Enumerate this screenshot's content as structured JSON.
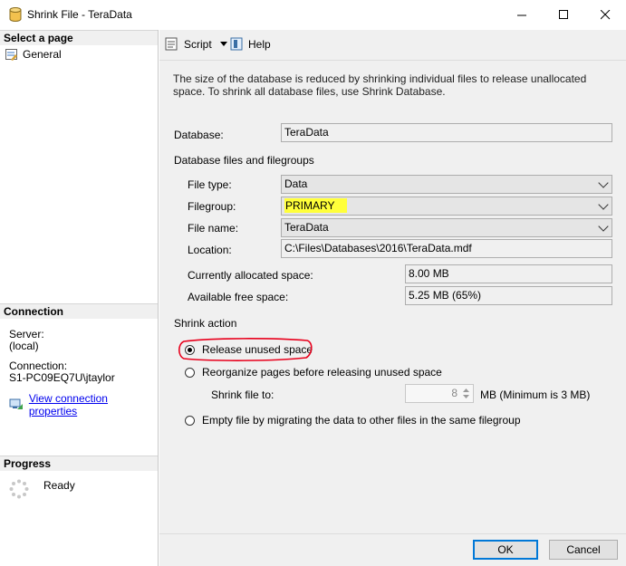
{
  "window": {
    "title": "Shrink File - TeraData"
  },
  "left": {
    "select_page_header": "Select a page",
    "pages": [
      {
        "label": "General"
      }
    ],
    "connection_header": "Connection",
    "server_label": "Server:",
    "server_value": "(local)",
    "connection_label": "Connection:",
    "connection_value": "S1-PC09EQ7U\\jtaylor",
    "view_connection_link": "View connection properties",
    "progress_header": "Progress",
    "progress_status": "Ready"
  },
  "toolbar": {
    "script_label": "Script",
    "help_label": "Help"
  },
  "main": {
    "description": "The size of the database is reduced by shrinking individual files to release unallocated space. To shrink all database files, use Shrink Database.",
    "database_label": "Database:",
    "database_value": "TeraData",
    "files_group_label": "Database files and filegroups",
    "file_type_label": "File type:",
    "file_type_value": "Data",
    "filegroup_label": "Filegroup:",
    "filegroup_value": "PRIMARY",
    "file_name_label": "File name:",
    "file_name_value": "TeraData",
    "location_label": "Location:",
    "location_value": "C:\\Files\\Databases\\2016\\TeraData.mdf",
    "allocated_label": "Currently allocated space:",
    "allocated_value": "8.00 MB",
    "free_label": "Available free space:",
    "free_value": "5.25 MB (65%)",
    "shrink_action_label": "Shrink action",
    "option_release": "Release unused space",
    "option_reorganize": "Reorganize pages before releasing unused space",
    "shrink_to_label": "Shrink file to:",
    "shrink_to_value": "8",
    "shrink_to_unit": "MB (Minimum is 3 MB)",
    "option_empty": "Empty file by migrating the data to other files in the same filegroup",
    "selected_option": "release"
  },
  "footer": {
    "ok_label": "OK",
    "cancel_label": "Cancel"
  },
  "colors": {
    "highlight": "#ffff3a",
    "annotation": "#e8001c",
    "accent": "#0078d7"
  }
}
